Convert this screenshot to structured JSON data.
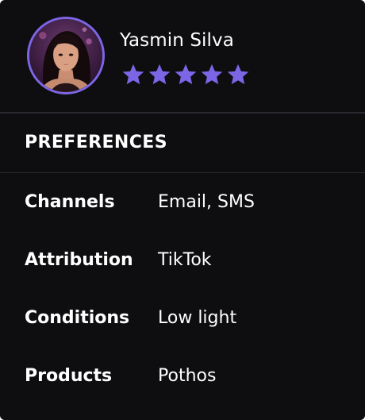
{
  "profile": {
    "name": "Yasmin Silva",
    "avatar_icon": "user-avatar-photo",
    "rating": 5,
    "rating_max": 5,
    "star_color": "#7c66e6"
  },
  "preferences": {
    "title": "PREFERENCES",
    "rows": [
      {
        "label": "Channels",
        "value": "Email, SMS"
      },
      {
        "label": "Attribution",
        "value": "TikTok"
      },
      {
        "label": "Conditions",
        "value": "Low light"
      },
      {
        "label": "Products",
        "value": "Pothos"
      }
    ]
  },
  "colors": {
    "card_background": "#0e0d10",
    "accent": "#7c66e6",
    "divider": "#2b292f",
    "text": "#ffffff"
  }
}
